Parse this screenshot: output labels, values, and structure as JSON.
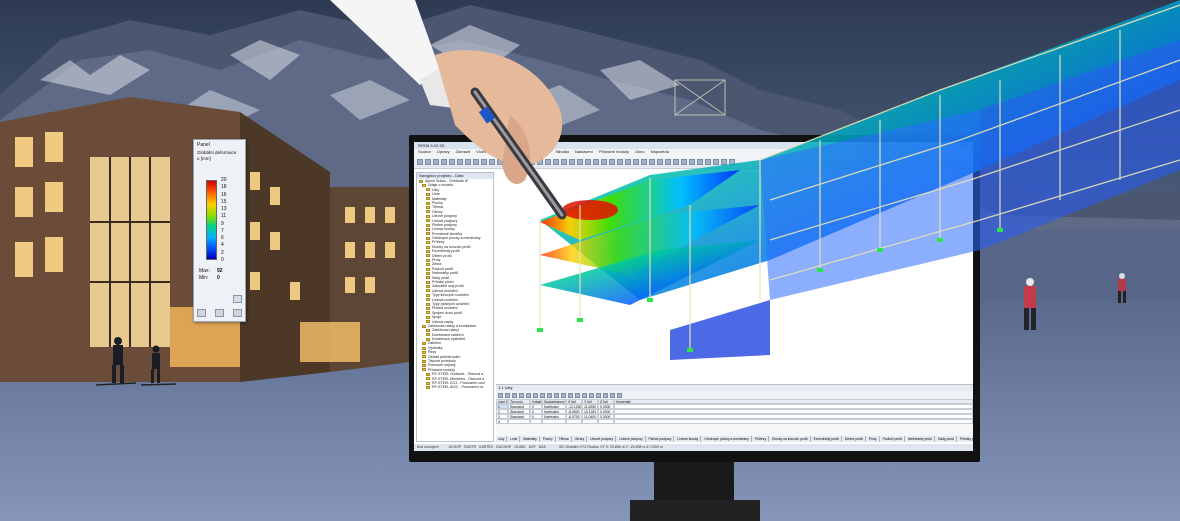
{
  "scene": {
    "colors": {
      "sky": "#2e3a52",
      "snow": "#7e8fb0",
      "accent_red": "#d20000",
      "accent_blue": "#0050ff",
      "fem_green": "#3ce000"
    }
  },
  "legend_panel": {
    "title": "Panel",
    "subtitle": "Globální deformace",
    "unit": "u [mm]",
    "ticks": [
      "20",
      "18",
      "16",
      "15",
      "13",
      "11",
      "9",
      "7",
      "6",
      "4",
      "2",
      "0"
    ],
    "max_label": "Max:",
    "max_value": "92",
    "min_label": "Min:",
    "min_value": "0"
  },
  "app": {
    "title": "RFEM 5.03 3D",
    "menu": [
      "Soubor",
      "Úpravy",
      "Zobrazit",
      "Vložit",
      "Výpočet",
      "Výsledky",
      "Nástroje",
      "Tabulka",
      "Nastavení",
      "Přídavné moduly",
      "Okno",
      "Nápověda"
    ],
    "navigator": {
      "header": "Navigátor projektu - Data",
      "items": [
        "Alpine Suites - Gebäude A*",
        "Údaje o modelu",
        "Uzly",
        "Linie",
        "Materiály",
        "Plochy",
        "Tělesa",
        "Otvory",
        "Uzlové podpory",
        "Liniové podpory",
        "Plošné podpory",
        "Liniové klouby",
        "Proměnné tloušťky",
        "Ortotropní plochy a membrány",
        "Průřezy",
        "Klouby na koncích prutů",
        "Excentricity prutů",
        "Dělení prutů",
        "Pruty",
        "Žebra",
        "Podloží prutů",
        "Nelineárity prutů",
        "Sady prutů",
        "Průniky ploch",
        "Zabudělé uzly prutů",
        "Uzlová uvolnění",
        "Typy liniových uvolnění",
        "Liniová uvolnění",
        "Typy plošných uvolnění",
        "Plošná uvolnění",
        "Spojení dvou prutů",
        "Spoje",
        "Uzlová vazby",
        "Zatěžovací stavy a kombinace",
        "Zatěžovací stavy",
        "Kombinace zatížení",
        "Kombinace výsledků",
        "Zatížení",
        "Výsledky",
        "Řezy",
        "Oblasti průměrování",
        "Tiskové protokoly",
        "Pomocné objekty",
        "Přídavné moduly",
        "RF-STEEL Surfaces - Obecná a",
        "RF-STEEL Members - Obecná a",
        "RF-STEEL EC3 - Posouzení ocel",
        "RF-STEEL AISC - Posouzení oc"
      ]
    },
    "table": {
      "title": "1.1 Uzly",
      "columns": [
        "Uzel č.",
        "Typ uzlu",
        "Vztažný uzel",
        "Souřadnicový systém",
        "X [m]",
        "Y [m]",
        "Z [m]",
        "Komentář"
      ],
      "column_group": "Souřadnice uzlu",
      "rows": [
        [
          "1",
          "Standard",
          "0",
          "Kartézský",
          "-12.1250",
          "11.6250",
          "0.0000",
          ""
        ],
        [
          "2",
          "Standard",
          "0",
          "Kartézský",
          "-8.0600",
          "15.1281",
          "0.0000",
          ""
        ],
        [
          "3",
          "Standard",
          "0",
          "Kartézský",
          "-8.0700",
          "11.0400",
          "0.0000",
          ""
        ],
        [
          "4",
          "",
          "",
          "",
          "",
          "",
          "",
          ""
        ]
      ]
    },
    "tabs": [
      "Uzly",
      "Linie",
      "Materiály",
      "Plochy",
      "Tělesa",
      "Otvory",
      "Uzlové podpory",
      "Liniové podpory",
      "Plošné podpory",
      "Liniové klouby",
      "Ortotropní plochy a membrány",
      "Průřezy",
      "Klouby na koncích prutů",
      "Excentricity prutů",
      "Dělení prutů",
      "Pruty",
      "Podloží prutů",
      "Nelineárity prutů",
      "Sady prutů",
      "Průniky ploch",
      "Zabudělé uzly prutů",
      "Uzlová uvolnění"
    ],
    "status": {
      "left": "Bod uchopení",
      "modes": [
        "UCHOP",
        "RASTR",
        "KARTÉZ",
        "OUCHOP",
        "GLINIE",
        "DXF",
        "NÁK"
      ],
      "coords": "SS: Globální XYZ  Rovina: XY  X: 29.856 m  Y: -20.508 m  Z: 0.000 m"
    }
  }
}
